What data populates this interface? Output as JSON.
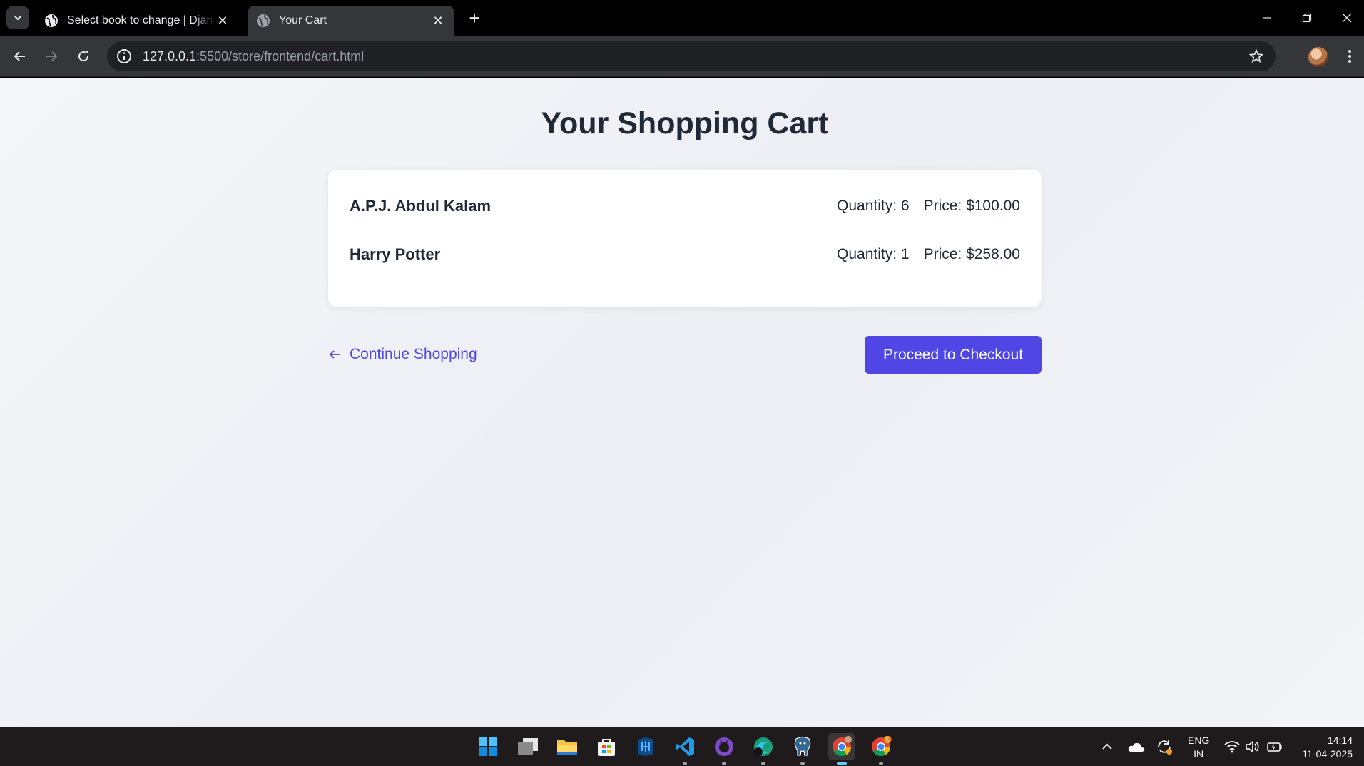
{
  "browser": {
    "tabs": [
      {
        "title": "Select book to change | Django",
        "active": false
      },
      {
        "title": "Your Cart",
        "active": true
      }
    ],
    "new_tab": "+",
    "url": {
      "host": "127.0.0.1",
      "path": ":5500/store/frontend/cart.html"
    }
  },
  "page": {
    "title": "Your Shopping Cart",
    "items": [
      {
        "name": "A.P.J. Abdul Kalam",
        "quantity": "Quantity: 6",
        "price": "Price: $100.00"
      },
      {
        "name": "Harry Potter",
        "quantity": "Quantity: 1",
        "price": "Price: $258.00"
      }
    ],
    "continue_label": "Continue Shopping",
    "checkout_label": "Proceed to Checkout",
    "accent_color": "#4f46e5"
  },
  "taskbar": {
    "apps": [
      "windows-start",
      "task-view",
      "file-explorer",
      "microsoft-store",
      "azure-data-studio",
      "vscode",
      "github-desktop",
      "edge-dev",
      "postgresql",
      "chrome",
      "chrome-profile"
    ],
    "chrome_badge": "5",
    "language": {
      "line1": "ENG",
      "line2": "IN"
    },
    "time": "14:14",
    "date": "11-04-2025"
  }
}
